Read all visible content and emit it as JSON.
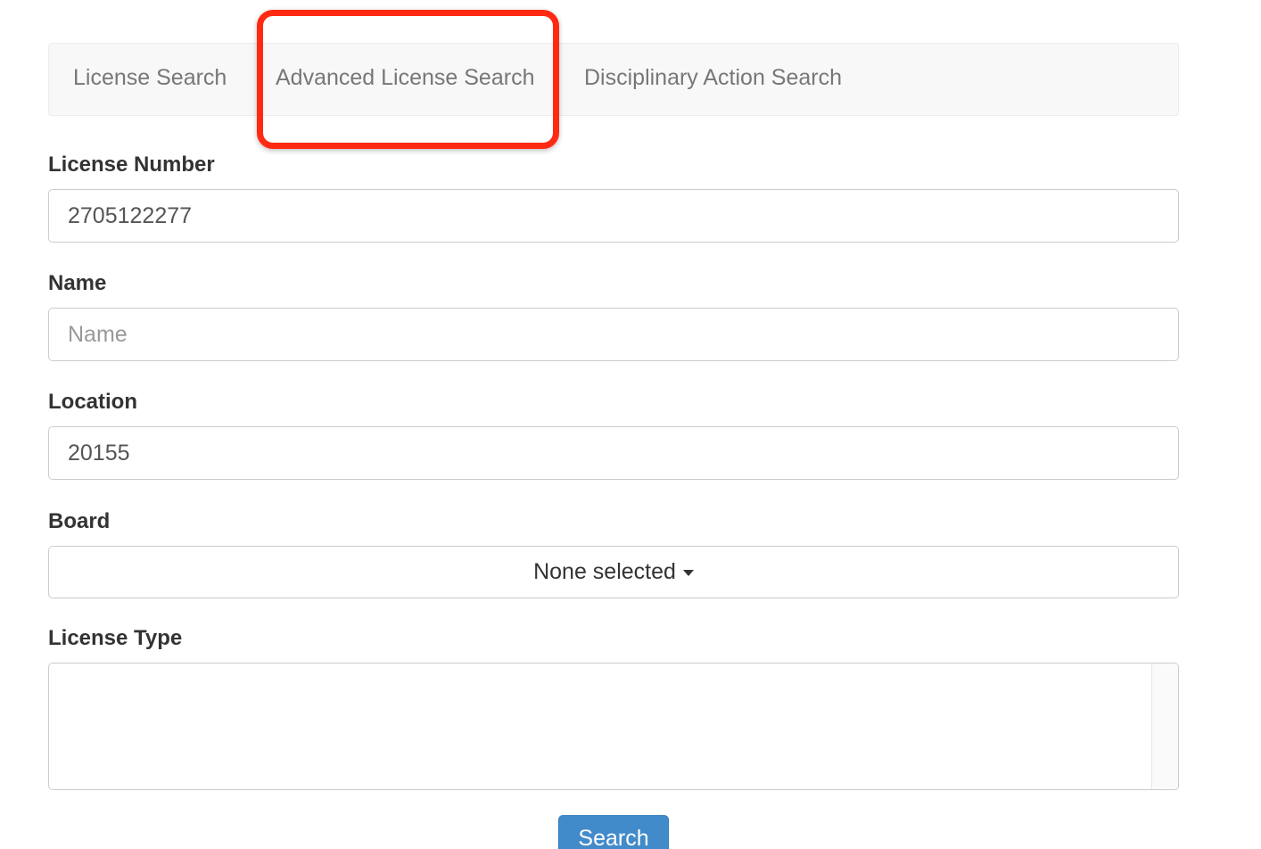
{
  "tabs": [
    {
      "label": "License Search"
    },
    {
      "label": "Advanced License Search"
    },
    {
      "label": "Disciplinary Action Search"
    }
  ],
  "highlight_color": "#ff2a12",
  "form": {
    "license_number": {
      "label": "License Number",
      "value": "2705122277",
      "placeholder": ""
    },
    "name": {
      "label": "Name",
      "value": "",
      "placeholder": "Name"
    },
    "location": {
      "label": "Location",
      "value": "20155",
      "placeholder": ""
    },
    "board": {
      "label": "Board",
      "selected": "None selected"
    },
    "license_type": {
      "label": "License Type"
    }
  },
  "search_button": {
    "label": "Search",
    "color": "#428bca"
  }
}
